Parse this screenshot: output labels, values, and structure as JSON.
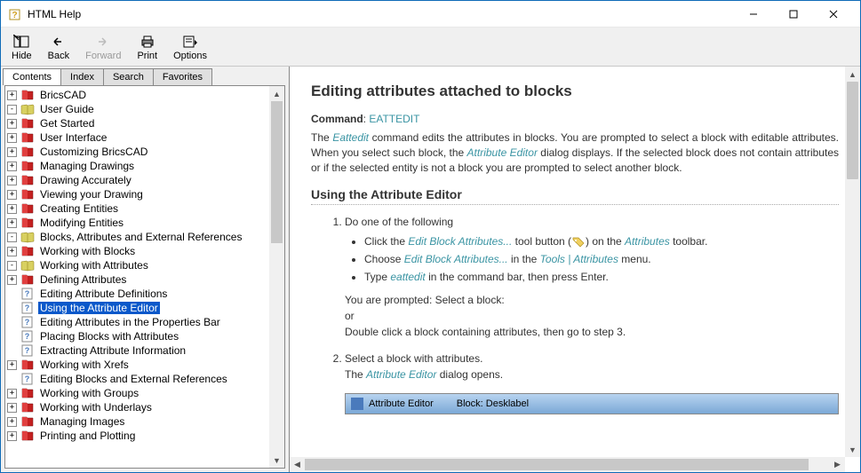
{
  "window": {
    "title": "HTML Help"
  },
  "toolbar": {
    "hide": "Hide",
    "back": "Back",
    "forward": "Forward",
    "print": "Print",
    "options": "Options"
  },
  "tabs": {
    "contents": "Contents",
    "index": "Index",
    "search": "Search",
    "favorites": "Favorites"
  },
  "tree": {
    "bricscad": "BricsCAD",
    "user_guide": "User Guide",
    "get_started": "Get Started",
    "user_interface": "User Interface",
    "customizing_bricscad": "Customizing BricsCAD",
    "managing_drawings": "Managing Drawings",
    "drawing_accurately": "Drawing Accurately",
    "viewing_your_drawing": "Viewing your Drawing",
    "creating_entities": "Creating Entities",
    "modifying_entities": "Modifying Entities",
    "blocks_attributes_xrefs": "Blocks, Attributes and External References",
    "working_with_blocks": "Working with Blocks",
    "working_with_attributes": "Working with Attributes",
    "defining_attributes": "Defining Attributes",
    "editing_attribute_definitions": "Editing Attribute Definitions",
    "using_the_attribute_editor": "Using the Attribute Editor",
    "editing_attributes_in_properties_bar": "Editing Attributes in the Properties Bar",
    "placing_blocks_with_attributes": "Placing Blocks with Attributes",
    "extracting_attribute_information": "Extracting Attribute Information",
    "working_with_xrefs": "Working with Xrefs",
    "editing_blocks_and_xrefs": "Editing Blocks and External References",
    "working_with_groups": "Working with Groups",
    "working_with_underlays": "Working with Underlays",
    "managing_images": "Managing Images",
    "printing_and_plotting": "Printing and Plotting"
  },
  "content": {
    "h1": "Editing attributes attached to blocks",
    "command_label": "Command",
    "command_name": "EATTEDIT",
    "p1_a": "The ",
    "p1_b": "Eattedit",
    "p1_c": " command edits the attributes in blocks. You are prompted to select a block with editable attributes. When you select such block, the ",
    "p1_d": "Attribute Editor",
    "p1_e": " dialog displays. If the selected block does not contain attributes or if the selected entity is not a block you are prompted to select another block.",
    "h2": "Using the Attribute Editor",
    "ol1": {
      "text": "Do one of the following",
      "b1_a": "Click the ",
      "b1_b": "Edit Block Attributes...",
      "b1_c": " tool button (",
      "b1_d": ") on the ",
      "b1_e": "Attributes",
      "b1_f": " toolbar.",
      "b2_a": "Choose ",
      "b2_b": "Edit Block Attributes...",
      "b2_c": " in the ",
      "b2_d": "Tools | Attributes",
      "b2_e": " menu.",
      "b3_a": "Type ",
      "b3_b": "eattedit",
      "b3_c": " in the command bar, then press Enter.",
      "prompt": "You are prompted: Select a block:",
      "or": "or",
      "dbl": "Double click a block containing attributes, then go to step 3."
    },
    "ol2": {
      "text": "Select a block with attributes.",
      "sub_a": "The ",
      "sub_b": "Attribute Editor",
      "sub_c": " dialog opens."
    },
    "dialog": {
      "title": "Attribute Editor",
      "block_label": "Block: Desklabel"
    }
  }
}
